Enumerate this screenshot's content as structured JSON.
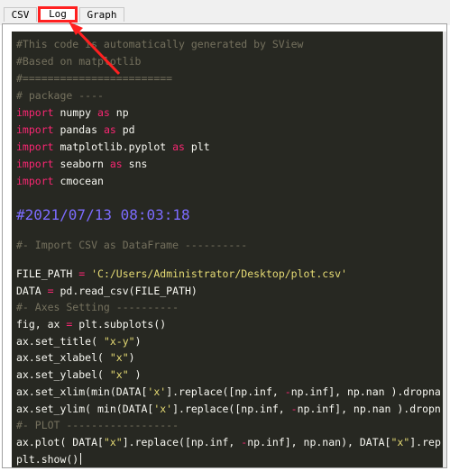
{
  "tabs": [
    "CSV",
    "Log",
    "Graph"
  ],
  "lines": {
    "c1": "#This code is automatically generated by SView",
    "c2": "#Based on matplotlib",
    "c3": "#========================",
    "c4": "# package ----",
    "imp1": [
      "import",
      " numpy ",
      "as",
      " np"
    ],
    "imp2": [
      "import",
      " pandas ",
      "as",
      " pd"
    ],
    "imp3": [
      "import",
      " matplotlib.pyplot ",
      "as",
      " plt"
    ],
    "imp4": [
      "import",
      " seaborn ",
      "as",
      " sns"
    ],
    "imp5": [
      "import",
      " cmocean"
    ],
    "date": "#2021/07/13 08:03:18",
    "c5": "#- Import CSV as DataFrame ----------",
    "fp": [
      "FILE_PATH ",
      "=",
      " 'C:/Users/Administrator/Desktop/plot.csv'"
    ],
    "dt": [
      "DATA ",
      "=",
      " pd.read_csv(FILE_PATH)"
    ],
    "c6": "#- Axes Setting ----------",
    "fig": [
      "fig, ax ",
      "=",
      " plt.subplots()"
    ],
    "title": [
      "ax.set_title( ",
      "\"x-y\"",
      ")"
    ],
    "xlabel": [
      "ax.set_xlabel( ",
      "\"x\"",
      ")"
    ],
    "ylabel": [
      "ax.set_ylabel( ",
      "\"x\"",
      " )"
    ],
    "xlim": [
      "ax.set_xlim(min(DATA[",
      "'x'",
      "].replace([np.inf, ",
      "-",
      "np.inf], np.nan ).dropna",
      ""
    ],
    "ylim": [
      "ax.set_ylim( min(DATA[",
      "'x'",
      "].replace([np.inf, ",
      "-",
      "np.inf], np.nan ).dropn",
      ""
    ],
    "c7": "#- PLOT ------------------",
    "plot": [
      "ax.plot( DATA[",
      "\"x\"",
      "].replace([np.inf, ",
      "-",
      "np.inf], np.nan), DATA[",
      "\"x\"",
      "].rep"
    ],
    "show": "plt.show()"
  }
}
